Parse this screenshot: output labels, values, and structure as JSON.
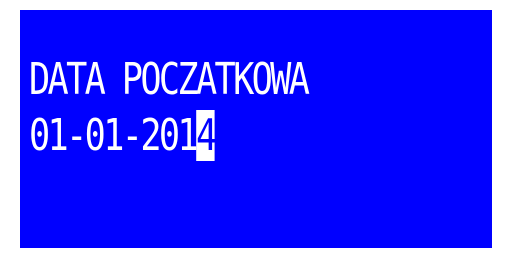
{
  "screen": {
    "label": "DATA POCZATKOWA",
    "value_before_cursor": "01-01-201",
    "cursor_char": "4",
    "colors": {
      "background": "#0000ff",
      "text": "#ffffff",
      "cursor_background": "#ffffff",
      "cursor_text": "#0000ff"
    }
  }
}
